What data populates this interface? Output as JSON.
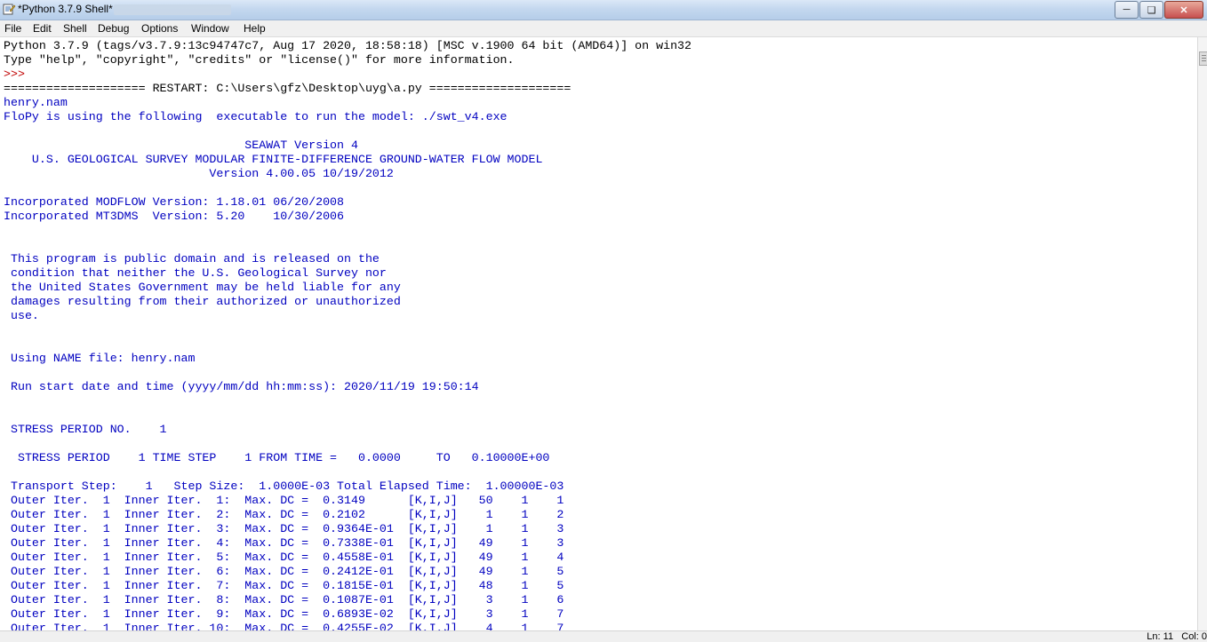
{
  "window": {
    "title": "*Python 3.7.9 Shell*"
  },
  "menu": [
    "File",
    "Edit",
    "Shell",
    "Debug",
    "Options",
    "Window",
    "Help"
  ],
  "status": {
    "line": "Ln: 11",
    "col": "Col: 0"
  },
  "shell": {
    "lines": [
      {
        "text": "Python 3.7.9 (tags/v3.7.9:13c94747c7, Aug 17 2020, 18:58:18) [MSC v.1900 64 bit (AMD64)] on win32",
        "kind": "std"
      },
      {
        "text": "Type \"help\", \"copyright\", \"credits\" or \"license()\" for more information.",
        "kind": "std"
      },
      {
        "text": ">>> ",
        "kind": "prompt"
      },
      {
        "text": "==================== RESTART: C:\\Users\\gfz\\Desktop\\uyg\\a.py ====================",
        "kind": "restart"
      },
      {
        "text": "henry.nam",
        "kind": "out"
      },
      {
        "text": "FloPy is using the following  executable to run the model: ./swt_v4.exe",
        "kind": "out"
      },
      {
        "text": "",
        "kind": "out"
      },
      {
        "text": "                                  SEAWAT Version 4",
        "kind": "out"
      },
      {
        "text": "    U.S. GEOLOGICAL SURVEY MODULAR FINITE-DIFFERENCE GROUND-WATER FLOW MODEL",
        "kind": "out"
      },
      {
        "text": "                             Version 4.00.05 10/19/2012",
        "kind": "out"
      },
      {
        "text": "",
        "kind": "out"
      },
      {
        "text": "Incorporated MODFLOW Version: 1.18.01 06/20/2008",
        "kind": "out"
      },
      {
        "text": "Incorporated MT3DMS  Version: 5.20    10/30/2006",
        "kind": "out"
      },
      {
        "text": "",
        "kind": "out"
      },
      {
        "text": "",
        "kind": "out"
      },
      {
        "text": " This program is public domain and is released on the",
        "kind": "out"
      },
      {
        "text": " condition that neither the U.S. Geological Survey nor",
        "kind": "out"
      },
      {
        "text": " the United States Government may be held liable for any",
        "kind": "out"
      },
      {
        "text": " damages resulting from their authorized or unauthorized",
        "kind": "out"
      },
      {
        "text": " use.",
        "kind": "out"
      },
      {
        "text": "",
        "kind": "out"
      },
      {
        "text": "",
        "kind": "out"
      },
      {
        "text": " Using NAME file: henry.nam",
        "kind": "out"
      },
      {
        "text": "",
        "kind": "out"
      },
      {
        "text": " Run start date and time (yyyy/mm/dd hh:mm:ss): 2020/11/19 19:50:14",
        "kind": "out"
      },
      {
        "text": "",
        "kind": "out"
      },
      {
        "text": "",
        "kind": "out"
      },
      {
        "text": " STRESS PERIOD NO.    1",
        "kind": "out"
      },
      {
        "text": "",
        "kind": "out"
      },
      {
        "text": "  STRESS PERIOD    1 TIME STEP    1 FROM TIME =   0.0000     TO   0.10000E+00",
        "kind": "out"
      },
      {
        "text": "",
        "kind": "out"
      },
      {
        "text": " Transport Step:    1   Step Size:  1.0000E-03 Total Elapsed Time:  1.00000E-03",
        "kind": "out"
      },
      {
        "text": " Outer Iter.  1  Inner Iter.  1:  Max. DC =  0.3149      [K,I,J]   50    1    1",
        "kind": "out"
      },
      {
        "text": " Outer Iter.  1  Inner Iter.  2:  Max. DC =  0.2102      [K,I,J]    1    1    2",
        "kind": "out"
      },
      {
        "text": " Outer Iter.  1  Inner Iter.  3:  Max. DC =  0.9364E-01  [K,I,J]    1    1    3",
        "kind": "out"
      },
      {
        "text": " Outer Iter.  1  Inner Iter.  4:  Max. DC =  0.7338E-01  [K,I,J]   49    1    3",
        "kind": "out"
      },
      {
        "text": " Outer Iter.  1  Inner Iter.  5:  Max. DC =  0.4558E-01  [K,I,J]   49    1    4",
        "kind": "out"
      },
      {
        "text": " Outer Iter.  1  Inner Iter.  6:  Max. DC =  0.2412E-01  [K,I,J]   49    1    5",
        "kind": "out"
      },
      {
        "text": " Outer Iter.  1  Inner Iter.  7:  Max. DC =  0.1815E-01  [K,I,J]   48    1    5",
        "kind": "out"
      },
      {
        "text": " Outer Iter.  1  Inner Iter.  8:  Max. DC =  0.1087E-01  [K,I,J]    3    1    6",
        "kind": "out"
      },
      {
        "text": " Outer Iter.  1  Inner Iter.  9:  Max. DC =  0.6893E-02  [K,I,J]    3    1    7",
        "kind": "out"
      },
      {
        "text": " Outer Iter.  1  Inner Iter. 10:  Max. DC =  0.4255E-02  [K,I,J]    4    1    7",
        "kind": "out"
      }
    ]
  },
  "colors": {
    "output": "#0000c0",
    "stdout": "#000000",
    "prompt": "#c00000"
  }
}
